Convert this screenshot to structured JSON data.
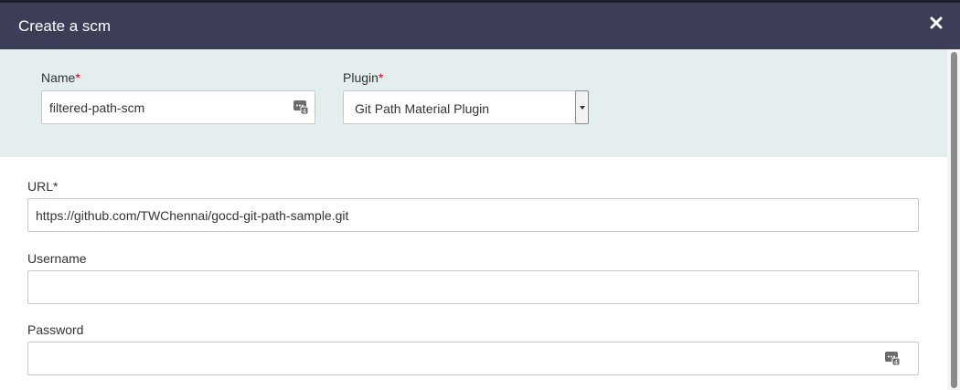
{
  "modal": {
    "title": "Create a scm",
    "close_icon": "close-icon"
  },
  "plugin_section": {
    "name": {
      "label": "Name",
      "required_mark": "*",
      "value": "filtered-path-scm",
      "icon": "password-manager-icon"
    },
    "plugin": {
      "label": "Plugin",
      "required_mark": "*",
      "selected": "Git Path Material Plugin"
    }
  },
  "form": {
    "url": {
      "label": "URL*",
      "value": "https://github.com/TWChennai/gocd-git-path-sample.git"
    },
    "username": {
      "label": "Username",
      "value": ""
    },
    "password": {
      "label": "Password",
      "value": "",
      "icon": "password-manager-icon"
    }
  },
  "colors": {
    "header_bg": "#3c3e57",
    "section_bg": "#e5eeef",
    "required": "#d0021b"
  }
}
